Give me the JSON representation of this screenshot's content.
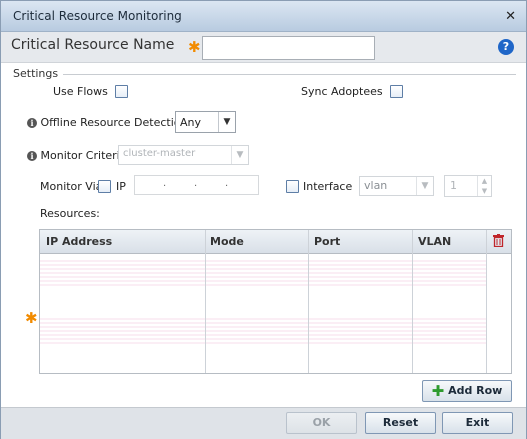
{
  "window": {
    "title": "Critical Resource Monitoring"
  },
  "name_bar": {
    "label": "Critical Resource Name",
    "value": "",
    "help_glyph": "?"
  },
  "settings": {
    "section_label": "Settings",
    "use_flows_label": "Use Flows",
    "use_flows_checked": false,
    "sync_adoptees_label": "Sync Adoptees",
    "sync_adoptees_checked": false,
    "offline_detection_label": "Offline Resource Detection",
    "offline_detection_value": "Any",
    "monitor_criteria_label": "Monitor Criteria",
    "monitor_criteria_value": "cluster-master",
    "monitor_via_label": "Monitor Via",
    "ip_label": "IP",
    "ip_checked": false,
    "ip_dots": [
      ".",
      ".",
      "."
    ],
    "interface_label": "Interface",
    "interface_checked": false,
    "interface_type_value": "vlan",
    "interface_number_value": "1",
    "resources_label": "Resources:"
  },
  "resources_table": {
    "columns": [
      "IP Address",
      "Mode",
      "Port",
      "VLAN"
    ],
    "rows": []
  },
  "buttons": {
    "add_row": "Add Row",
    "ok": "OK",
    "reset": "Reset",
    "exit": "Exit"
  },
  "colors": {
    "accent": "#1f66c8",
    "required_star": "#f28b00",
    "delete_icon": "#c0262b",
    "add_icon": "#2e9b2e"
  }
}
